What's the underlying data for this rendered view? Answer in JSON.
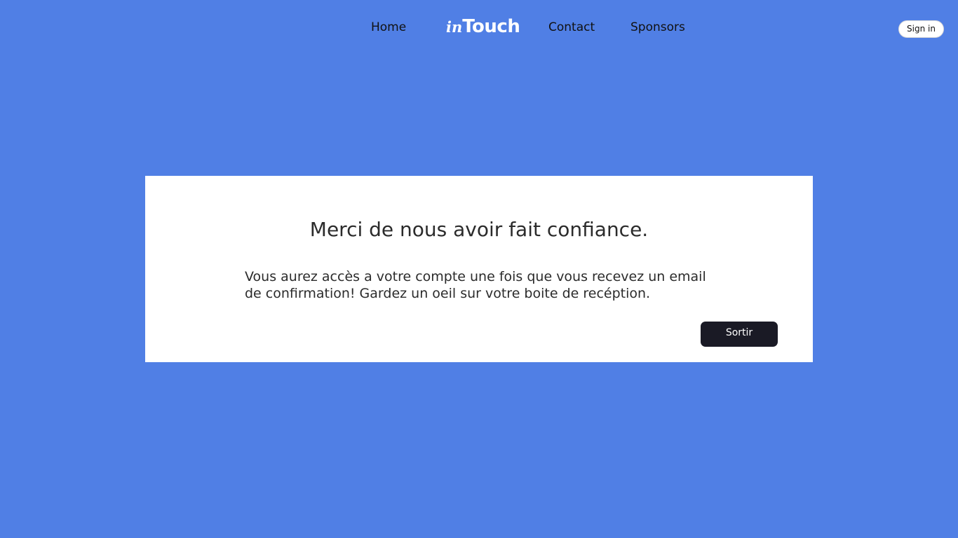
{
  "header": {
    "nav_home": "Home",
    "logo_in": "in",
    "logo_touch": "Touch",
    "nav_contact": "Contact",
    "nav_sponsors": "Sponsors",
    "signin_label": "Sign in"
  },
  "card": {
    "title": "Merci de nous avoir fait confiance.",
    "message": "Vous aurez accès a votre compte une fois que vous recevez un email de confirmation! Gardez un oeil sur votre boite de recéption.",
    "exit_label": "Sortir"
  },
  "colors": {
    "background": "#507fe5",
    "card": "#ffffff",
    "button_dark": "#1a1a25"
  }
}
